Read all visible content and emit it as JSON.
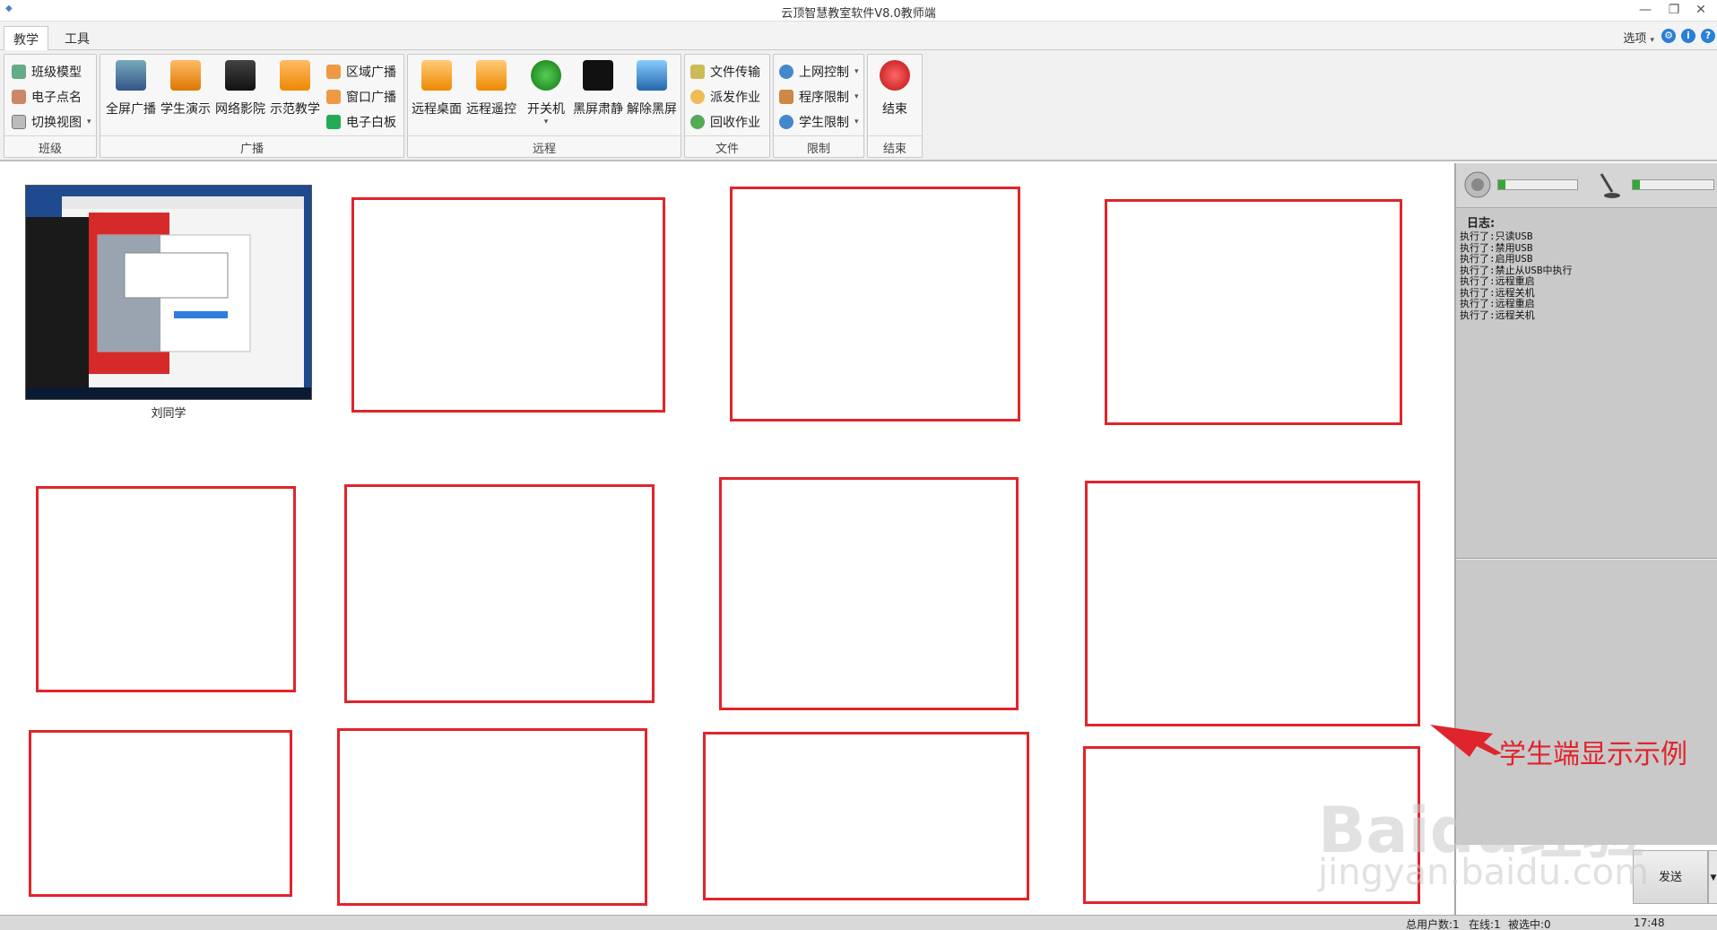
{
  "window": {
    "title": "云顶智慧教室软件V8.0教师端",
    "controls": [
      "—",
      "❐",
      "✕"
    ]
  },
  "tabs": [
    {
      "label": "教学"
    },
    {
      "label": "工具"
    }
  ],
  "options_label": "选项",
  "ribbon": {
    "class_group": {
      "label": "班级",
      "items": [
        {
          "label": "班级模型",
          "icon": "class-model-icon"
        },
        {
          "label": "电子点名",
          "icon": "roll-call-icon"
        },
        {
          "label": "切换视图",
          "icon": "switch-view-icon"
        }
      ]
    },
    "broadcast_group": {
      "label": "广播",
      "big_items": [
        {
          "label": "全屏广播",
          "icon": "fullscreen-broadcast-icon"
        },
        {
          "label": "学生演示",
          "icon": "student-demo-icon"
        },
        {
          "label": "网络影院",
          "icon": "network-cinema-icon"
        },
        {
          "label": "示范教学",
          "icon": "demo-teaching-icon"
        }
      ],
      "small_items": [
        {
          "label": "区域广播",
          "icon": "area-broadcast-icon"
        },
        {
          "label": "窗口广播",
          "icon": "window-broadcast-icon"
        },
        {
          "label": "电子白板",
          "icon": "whiteboard-icon"
        }
      ]
    },
    "remote_group": {
      "label": "远程",
      "items": [
        {
          "label": "远程桌面",
          "icon": "remote-desktop-icon"
        },
        {
          "label": "远程遥控",
          "icon": "remote-control-icon"
        },
        {
          "label": "开关机",
          "icon": "power-icon"
        },
        {
          "label": "黑屏肃静",
          "icon": "black-screen-icon"
        },
        {
          "label": "解除黑屏",
          "icon": "unblack-screen-icon"
        }
      ]
    },
    "file_group": {
      "label": "文件",
      "items": [
        {
          "label": "文件传输",
          "icon": "file-transfer-icon"
        },
        {
          "label": "派发作业",
          "icon": "dispatch-homework-icon"
        },
        {
          "label": "回收作业",
          "icon": "collect-homework-icon"
        }
      ]
    },
    "limit_group": {
      "label": "限制",
      "items": [
        {
          "label": "上网控制",
          "icon": "internet-control-icon"
        },
        {
          "label": "程序限制",
          "icon": "program-limit-icon"
        },
        {
          "label": "学生限制",
          "icon": "student-limit-icon"
        }
      ]
    },
    "end_group": {
      "label": "结束",
      "item": {
        "label": "结束",
        "icon": "end-icon"
      }
    }
  },
  "student": {
    "name": "刘同学"
  },
  "log": {
    "title": "日志:",
    "lines": [
      "执行了:只读USB",
      "执行了:禁用USB",
      "执行了:启用USB",
      "执行了:禁止从USB中执行",
      "执行了:远程重启",
      "执行了:远程关机",
      "执行了:远程重启",
      "执行了:远程关机"
    ]
  },
  "send_label": "发送",
  "status": {
    "total": "总用户数:1",
    "online": "在线:1",
    "selected": "被选中:0",
    "time": "17:48"
  },
  "annotation": {
    "text": "学生端显示示例",
    "color": "#e0242c"
  },
  "watermark": {
    "line1": "Baidu经验",
    "line2": "jingyan.baidu.com"
  },
  "colors": {
    "accent": "#2b7fd6",
    "frame": "#e0242c"
  }
}
